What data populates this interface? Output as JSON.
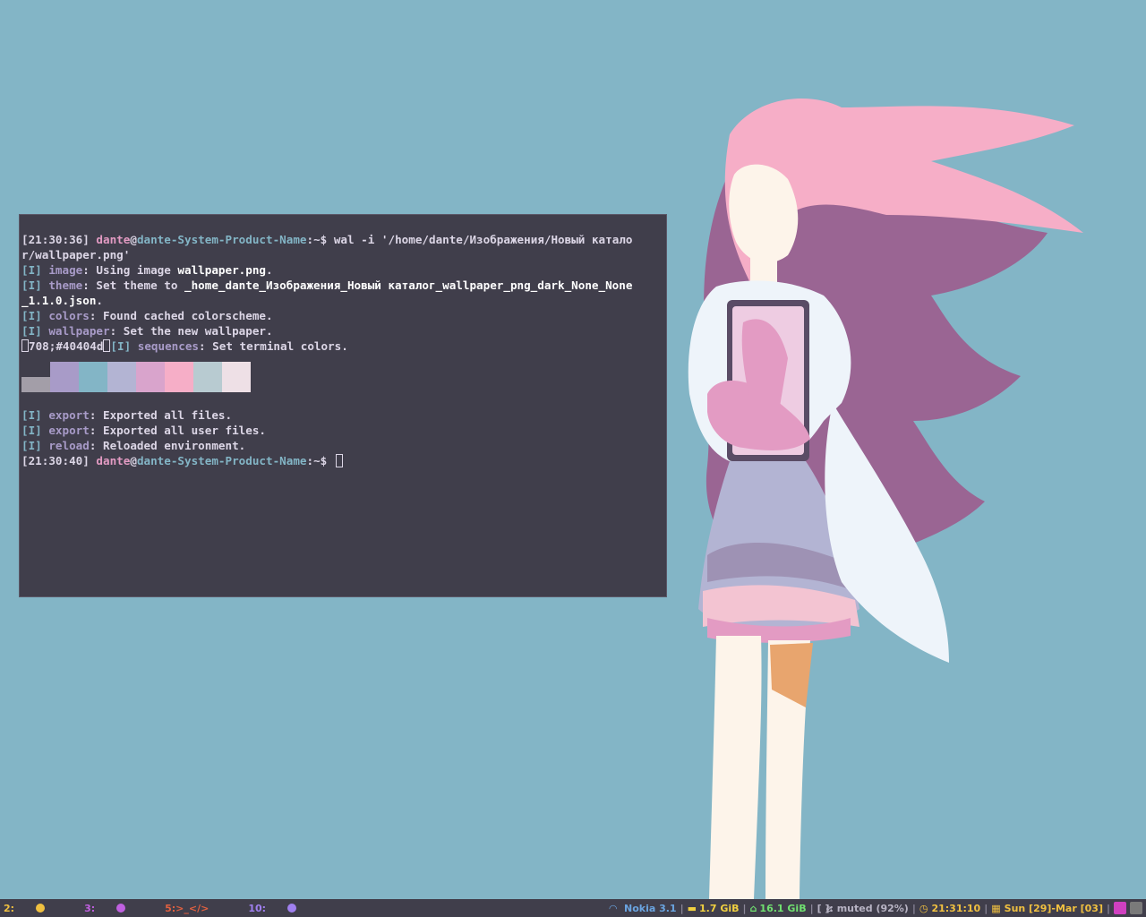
{
  "terminal": {
    "line1": {
      "ts": "[21:30:36]",
      "user": "dante",
      "at": "@",
      "host": "dante-System-Product-Name",
      "path": ":~$",
      "cmd": " wal -i '/home/dante/Изображения/Новый катало"
    },
    "line1b": "r/wallpaper.png'",
    "image": {
      "tag": "[I]",
      "mod": "image",
      "text": ": Using image ",
      "bold": "wallpaper.png",
      "end": "."
    },
    "theme": {
      "tag": "[I]",
      "mod": "theme",
      "text": ": Set theme to ",
      "bold": "_home_dante_Изображения_Новый каталог_wallpaper_png_dark_None_None",
      "bold2": "_1.1.0.json",
      "end": "."
    },
    "colors": {
      "tag": "[I]",
      "mod": "colors",
      "text": ": Found cached colorscheme."
    },
    "wallpaper": {
      "tag": "[I]",
      "mod": "wallpaper",
      "text": ": Set the new wallpaper."
    },
    "sequences": {
      "pre": "708;#40404d",
      "tag": "[I]",
      "mod": "sequences",
      "text": ": Set terminal colors."
    },
    "palette": [
      "#a39ea8",
      "#a89bc8",
      "#83b5c6",
      "#b3b4d3",
      "#d9a4cc",
      "#f6aec7",
      "#b8cbd1",
      "#eee0e6"
    ],
    "export1": {
      "tag": "[I]",
      "mod": "export",
      "text": ": Exported all files."
    },
    "export2": {
      "tag": "[I]",
      "mod": "export",
      "text": ": Exported all user files."
    },
    "reload": {
      "tag": "[I]",
      "mod": "reload",
      "text": ": Reloaded environment."
    },
    "prompt": {
      "ts": "[21:30:40]",
      "user": "dante",
      "at": "@",
      "host": "dante-System-Product-Name",
      "path": ":~$"
    }
  },
  "statusbar": {
    "workspaces": [
      {
        "label": "2:",
        "color": "#f0c040"
      },
      {
        "label": "3:",
        "color": "#c060e0"
      },
      {
        "label": "5:>_</>",
        "color": "#e06040"
      },
      {
        "label": "10:",
        "color": "#a080f0"
      }
    ],
    "wifi": "Nokia 3.1",
    "memory": "1.7 GiB",
    "disk": "16.1 GiB",
    "volume": "[  ]: muted (92%)",
    "clock": "21:31:10",
    "date": "Sun [29]-Mar [03]",
    "colors": {
      "wifi": "#6aa4e0",
      "memory": "#f0d040",
      "disk": "#70e070",
      "clock": "#f0c040",
      "date": "#f0c040"
    }
  }
}
